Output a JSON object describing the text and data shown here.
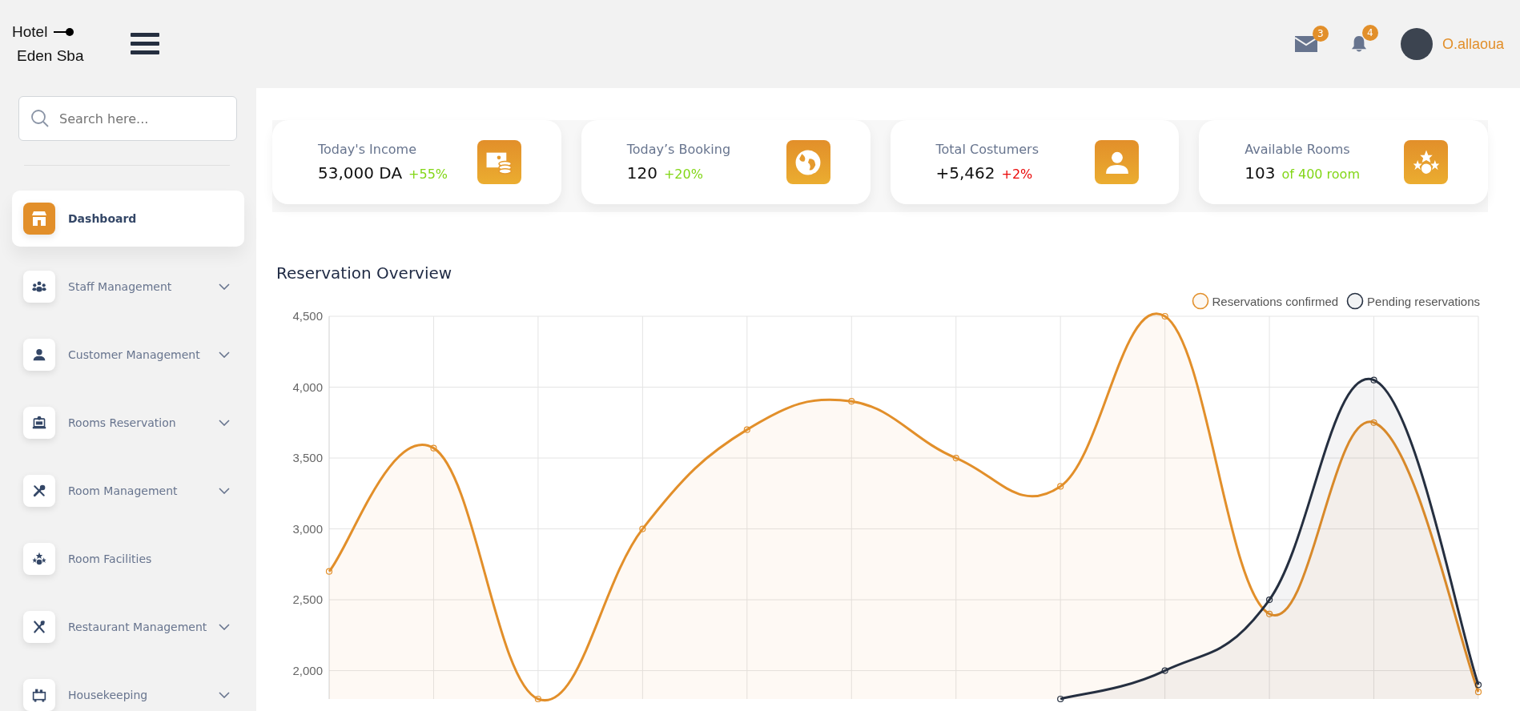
{
  "brand": {
    "line_1": "Hotel",
    "line_2": "Eden Sba"
  },
  "header": {
    "mail_badge": "3",
    "notification_badge": "4",
    "user_name": "O.allaoua"
  },
  "search": {
    "placeholder": "Search here..."
  },
  "sidebar": {
    "items": [
      {
        "label": "Dashboard",
        "selected": true,
        "has_submenu": false
      },
      {
        "label": "Staff Management",
        "selected": false,
        "has_submenu": true
      },
      {
        "label": "Customer Management",
        "selected": false,
        "has_submenu": true
      },
      {
        "label": "Rooms Reservation",
        "selected": false,
        "has_submenu": true
      },
      {
        "label": "Room Management",
        "selected": false,
        "has_submenu": true
      },
      {
        "label": "Room Facilities",
        "selected": false,
        "has_submenu": false
      },
      {
        "label": "Restaurant Management",
        "selected": false,
        "has_submenu": true
      },
      {
        "label": "Housekeeping",
        "selected": false,
        "has_submenu": true
      }
    ]
  },
  "stats": [
    {
      "label": "Today's Income",
      "value": "53,000 DA",
      "delta": "+55%",
      "color": "#82d616"
    },
    {
      "label": "Today’s Booking",
      "value": "120",
      "delta": "+20%",
      "color": "#82d616"
    },
    {
      "label": "Total Costumers",
      "value": "+5,462",
      "delta": "+2%",
      "color": "#ea0606"
    },
    {
      "label": "Available Rooms",
      "value": "103",
      "delta": "of 400 room",
      "color": "#82d616"
    }
  ],
  "chart": {
    "title": "Reservation Overview",
    "chart_data": {
      "type": "area",
      "grid": true,
      "ylim": [
        1800,
        4500
      ],
      "yticks": [
        {
          "value": 2000,
          "label": "2,000"
        },
        {
          "value": 2500,
          "label": "2,500"
        },
        {
          "value": 3000,
          "label": "3,000"
        },
        {
          "value": 3500,
          "label": "3,500"
        },
        {
          "value": 4000,
          "label": "4,000"
        },
        {
          "value": 4500,
          "label": "4,500"
        }
      ],
      "series": [
        {
          "name": "Reservations confirmed",
          "color": "#e28f2a",
          "values": [
            2700,
            3570,
            1800,
            3000,
            3700,
            3900,
            3500,
            3300,
            4500,
            2400,
            3750,
            1850
          ]
        },
        {
          "name": "Pending reservations",
          "color": "#252f40",
          "values": [
            null,
            null,
            null,
            null,
            null,
            null,
            null,
            1800,
            2000,
            2500,
            4050,
            1900
          ]
        }
      ]
    }
  }
}
